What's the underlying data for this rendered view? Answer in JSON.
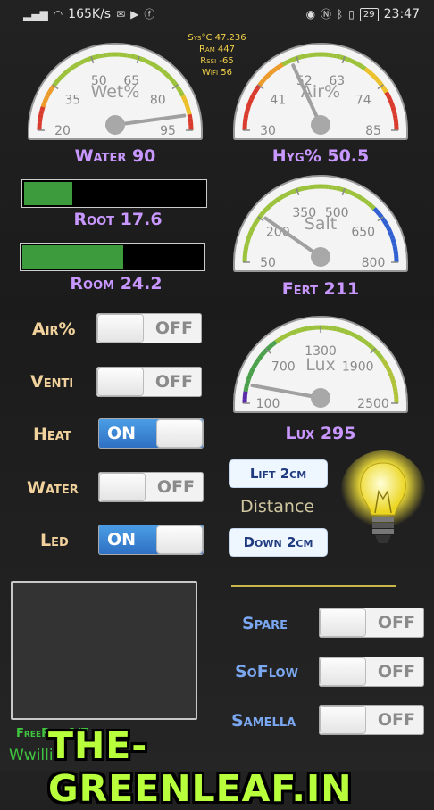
{
  "status_bar": {
    "speed": "165K/s",
    "battery": "29",
    "time": "23:47"
  },
  "sys_info": {
    "line1": "Sys°C 47.236",
    "line2": "Ram 447",
    "line3": "Rssi -65",
    "line4": "Wifi 56"
  },
  "gauges": {
    "wet": {
      "title": "Wet%",
      "ticks": [
        "20",
        "35",
        "50",
        "65",
        "80",
        "95"
      ],
      "min": 20,
      "max": 95,
      "value": 90,
      "label": "Water 90"
    },
    "air": {
      "title": "Air%",
      "ticks": [
        "30",
        "41",
        "52",
        "63",
        "74",
        "85"
      ],
      "min": 30,
      "max": 85,
      "value": 50.5,
      "label": "Hyg% 50.5"
    },
    "salt": {
      "title": "Salt",
      "ticks": [
        "50",
        "200",
        "350",
        "500",
        "650",
        "800"
      ],
      "min": 50,
      "max": 800,
      "value": 211,
      "label": "Fert 211"
    },
    "lux": {
      "title": "Lux",
      "ticks": [
        "100",
        "700",
        "1300",
        "1900",
        "2500"
      ],
      "min": 100,
      "max": 2500,
      "value": 295,
      "label": "Lux 295"
    }
  },
  "bars": {
    "root": {
      "label": "Root 17.6",
      "fraction": 0.28
    },
    "room": {
      "label": "Room 24.2",
      "fraction": 0.57
    }
  },
  "toggles": [
    {
      "label": "Air%",
      "state": "OFF"
    },
    {
      "label": "Venti",
      "state": "OFF"
    },
    {
      "label": "Heat",
      "state": "ON"
    },
    {
      "label": "Water",
      "state": "OFF"
    },
    {
      "label": "Led",
      "state": "ON"
    }
  ],
  "distance": {
    "up_button": "Lift 2cm",
    "label": "Distance",
    "down_button": "Down 2cm"
  },
  "aux_toggles": [
    {
      "label": "Spare",
      "state": "OFF"
    },
    {
      "label": "SoFlow",
      "state": "OFF"
    },
    {
      "label": "Samella",
      "state": "OFF"
    }
  ],
  "footer": {
    "freeram": "FreeRam 1/7",
    "user": "Wwilli",
    "watermark": "THE-GREENLEAF.IN"
  }
}
